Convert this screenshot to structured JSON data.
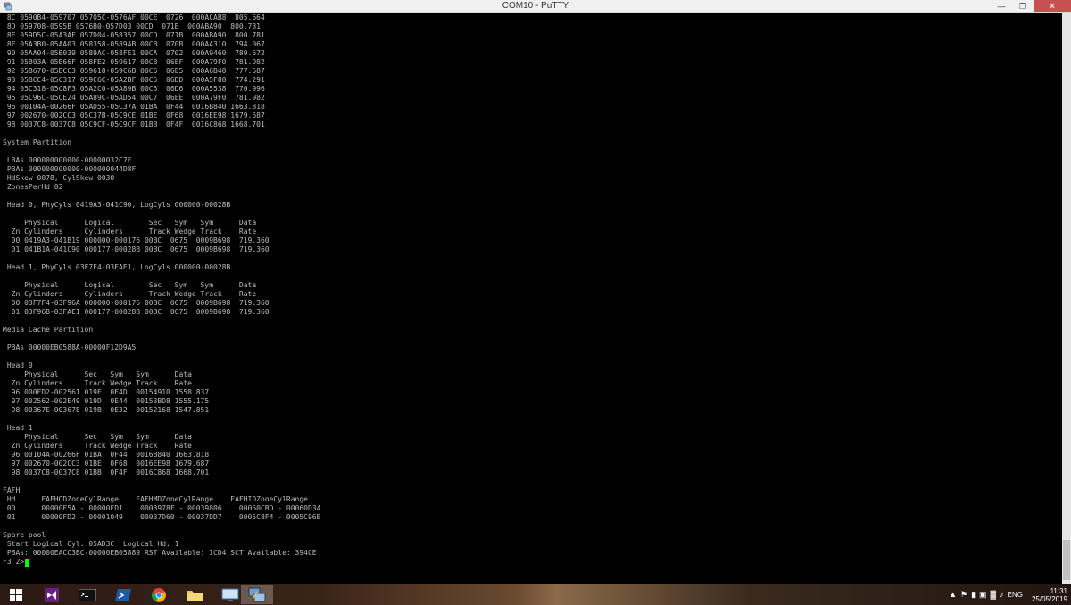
{
  "window": {
    "title": "COM10 - PuTTY"
  },
  "terminal": {
    "lines": [
      " 8C 0590B4-059707 05705C-0576AF 00CE  0726  000ACAB8  805.664",
      " 8D 059708-0595B 0576B0-057D03 00CD  071B  000ABA90  800.781",
      " 8E 059D5C-05A3AF 057D04-058357 00CD  071B  000ABA90  800.781",
      " 8F 05A3B0-05AA03 058358-0589AB 00CB  070B  000AA310  794.067",
      " 90 05AA04-05B039 0589AC-058FE1 00CA  0702  000A9460  789.672",
      " 91 05B03A-05B66F 058FE2-059617 00C8  06EF  000A79F0  781.982",
      " 92 05B670-05BCC3 059618-059C6B 00C6  06E5  000A6B40  777.587",
      " 93 05BCC4-05C317 059C6C-05A2BF 00C5  06DD  000A5F80  774.291",
      " 94 05C318-05C8F3 05A2C0-05A89B 00C5  06D6  000A5538  770.996",
      " 95 05C96C-05CE24 05A89C-05AD54 00C7  06EE  000A79F0  781.982",
      " 96 00104A-00266F 05AD55-05C37A 01BA  0F44  0016B840 1663.818",
      " 97 002670-002CC3 05C37B-05C9CE 01BE  0F68  0016EE98 1679.687",
      " 98 0037C8-0037C8 05C9CF-05C9CF 01BB  0F4F  0016C868 1668.701",
      "",
      "System Partition",
      "",
      " LBAs 000000000000-00000032C7F",
      " PBAs 000000000000-000000044D8F",
      " HdSkew 0078, CylSkew 0030",
      " ZonesPerHd 02",
      "",
      " Head 0, PhyCyls 0419A3-041C90, LogCyls 000000-00028B",
      "",
      "     Physical      Logical        Sec   Sym   Sym      Data",
      "  Zn Cylinders     Cylinders      Track Wedge Track    Rate",
      "  00 0419A3-041B19 000000-000176 00BC  0675  0009B698  719.360",
      "  01 041B1A-041C90 000177-00028B 00BC  0675  0009B698  719.360",
      "",
      " Head 1, PhyCyls 03F7F4-03FAE1, LogCyls 000000-00028B",
      "",
      "     Physical      Logical        Sec   Sym   Sym      Data",
      "  Zn Cylinders     Cylinders      Track Wedge Track    Rate",
      "  00 03F7F4-03F96A 000000-000176 00BC  0675  0009B698  719.360",
      "  01 03F96B-03FAE1 000177-00028B 00BC  0675  0009B698  719.360",
      "",
      "Media Cache Partition",
      "",
      " PBAs 00000EB0588A-00000F12D9A5",
      "",
      " Head 0",
      "     Physical      Sec   Sym   Sym      Data",
      "  Zn Cylinders     Track Wedge Track    Rate",
      "  96 000FD2-002561 019E  0E4D  00154910 1558.837",
      "  97 002562-002E49 019D  0E44  00153BD8 1555.175",
      "  98 00367E-00367E 019B  0E32  00152168 1547.851",
      "",
      " Head 1",
      "     Physical      Sec   Sym   Sym      Data",
      "  Zn Cylinders     Track Wedge Track    Rate",
      "  96 00104A-00266F 01BA  0F44  0016B840 1663.818",
      "  97 002670-002CC3 01BE  0F68  0016EE98 1679.687",
      "  98 0037C8-0037C8 01BB  0F4F  0016C868 1668.701",
      "",
      "FAFH",
      " Hd      FAFHODZoneCylRange    FAFHMDZoneCylRange    FAFHIDZoneCylRange",
      " 00      00000F5A - 00000FD1    0003978F - 00039806    00060CBD - 00060D34",
      " 01      00000FD2 - 00001049    00037D60 - 00037DD7    0005C8F4 - 0005C96B",
      "",
      "Spare pool",
      " Start Logical Cyl: 05AD3C  Logical Hd: 1",
      " PBAs: 00000EACC3BC-00000EB05889 RST Available: 1CD4 SCT Available: 394CE"
    ],
    "prompt": "F3 2>"
  },
  "taskbar": {
    "language": "ENG",
    "time": "11:31",
    "date": "25/05/2019"
  },
  "colors": {
    "terminal_text": "#bbbbbb",
    "cursor": "#00ff00",
    "background": "#000000"
  }
}
